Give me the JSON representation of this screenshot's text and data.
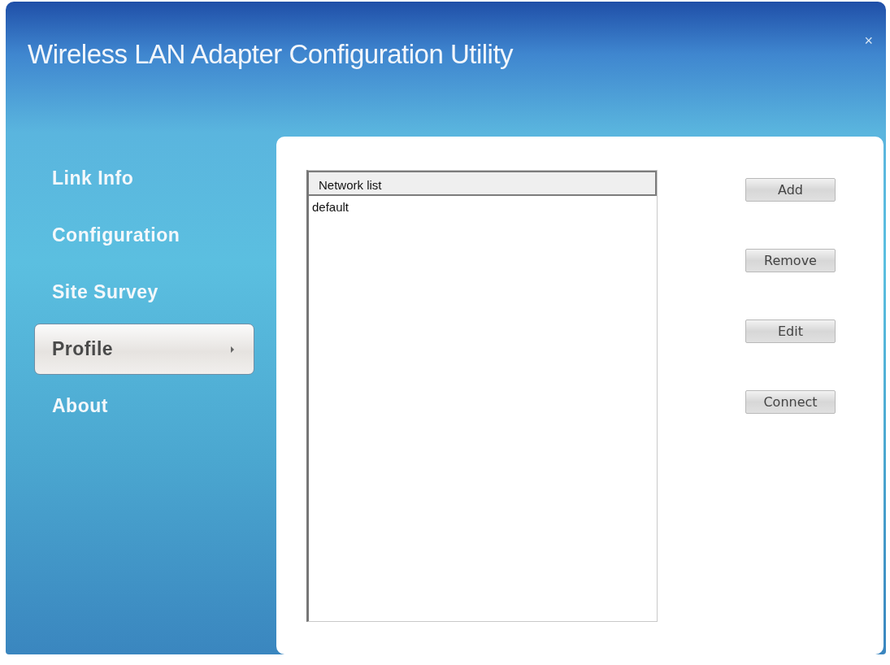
{
  "window": {
    "title": "Wireless LAN Adapter Configuration Utility",
    "close": "×"
  },
  "sidebar": {
    "items": [
      {
        "label": "Link Info",
        "selected": false
      },
      {
        "label": "Configuration",
        "selected": false
      },
      {
        "label": "Site Survey",
        "selected": false
      },
      {
        "label": "Profile",
        "selected": true
      },
      {
        "label": "About",
        "selected": false
      }
    ]
  },
  "network_list": {
    "header": "Network list",
    "rows": [
      {
        "name": "default",
        "selected": false
      }
    ]
  },
  "buttons": [
    "Add",
    "Remove",
    "Edit",
    "Connect"
  ]
}
